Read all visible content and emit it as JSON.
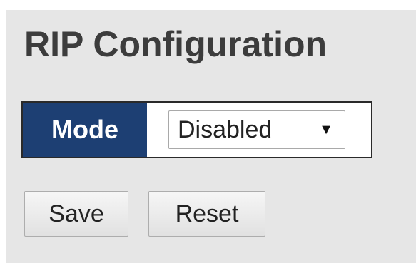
{
  "page": {
    "title": "RIP Configuration"
  },
  "mode": {
    "label": "Mode",
    "selected": "Disabled",
    "dropdown_icon": "triangle-down"
  },
  "buttons": {
    "save_label": "Save",
    "reset_label": "Reset"
  },
  "colors": {
    "header_cell": "#1d3f73",
    "panel_background": "#e6e6e6",
    "title_text": "#3c3c3c"
  }
}
